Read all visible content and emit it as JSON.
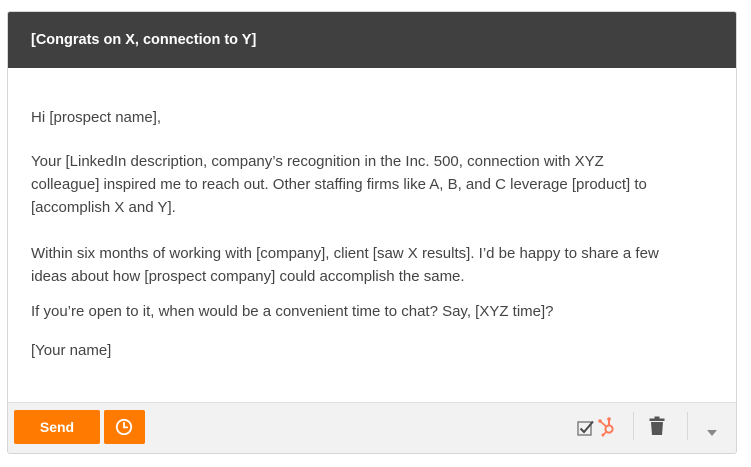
{
  "window": {
    "title": "[Congrats on X, connection to Y]"
  },
  "message": {
    "greeting": "Hi [prospect name],",
    "para1_line1": "Your [LinkedIn description, company’s recognition in the Inc. 500, connection with XYZ",
    "para1_line2": "colleague] inspired me to reach out. Other staffing firms like A, B, and C leverage [product] to",
    "para1_line3": "[accomplish X and Y].",
    "para2_line1": "Within six months of working with [company], client [saw X results]. I’d be happy to share a few",
    "para2_line2": "ideas about how [prospect company] could accomplish the same.",
    "para3": "If you’re open to it, when would be a convenient time to chat? Say, [XYZ time]?",
    "signature": "[Your name]"
  },
  "toolbar": {
    "send_label": "Send",
    "icons": [
      "clock-icon",
      "checkbox-icon",
      "hubspot-sprocket-icon",
      "trash-icon",
      "caret-down-icon"
    ]
  },
  "colors": {
    "titlebar": "#404040",
    "accent": "#ff7a00",
    "footer": "#f2f2f2",
    "text": "#444444"
  }
}
